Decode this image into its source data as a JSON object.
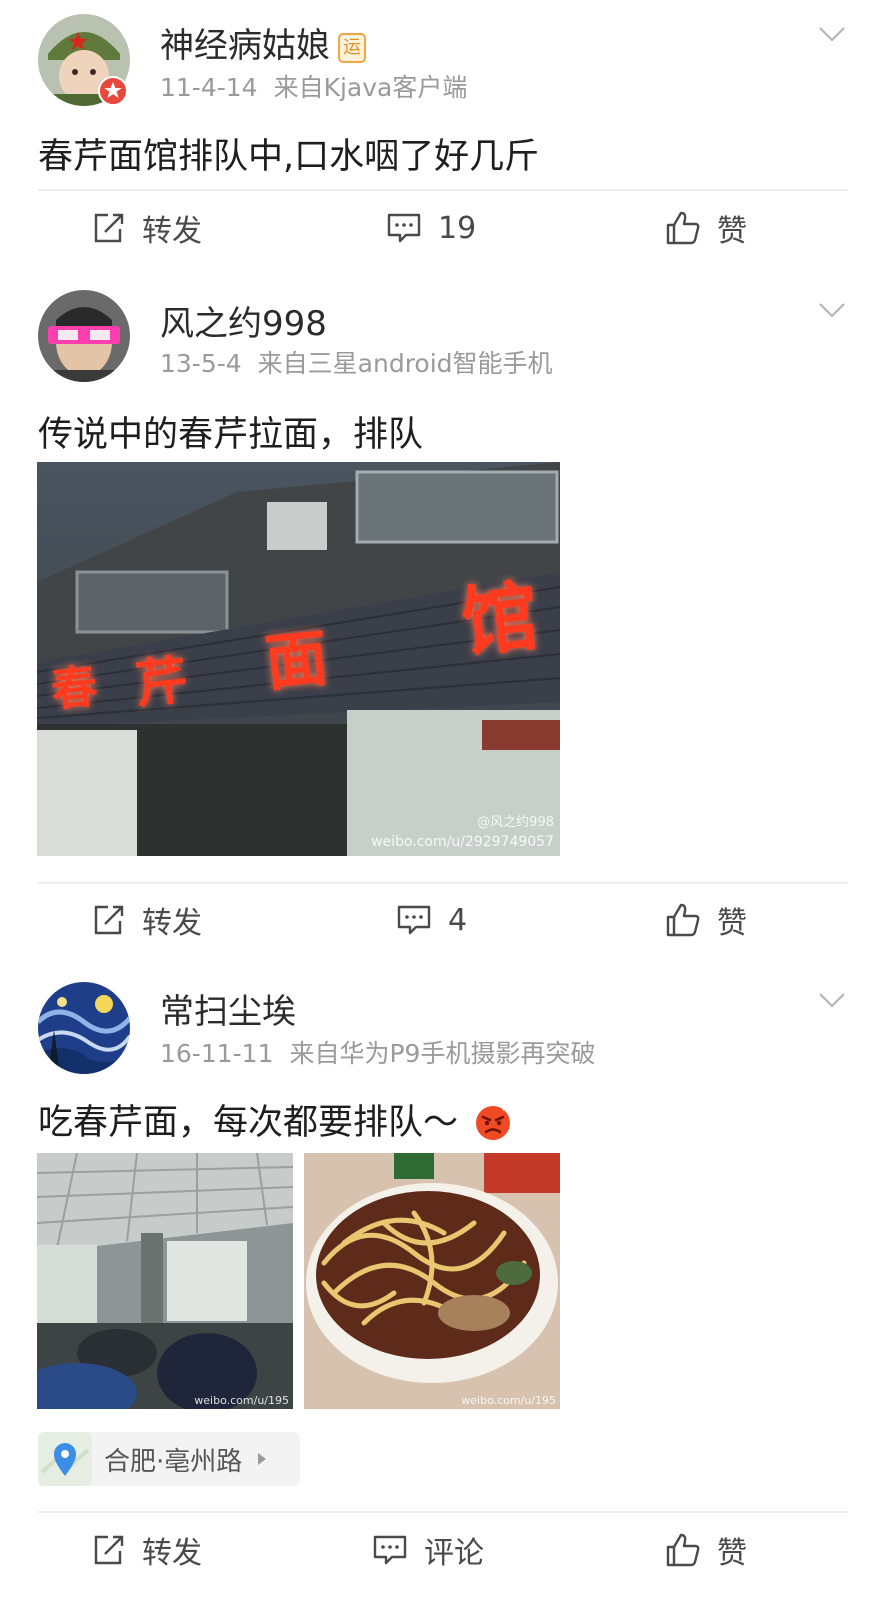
{
  "posts": [
    {
      "username": "神经病姑娘",
      "badge": "运",
      "date": "11-4-14",
      "source": "来自Kjava客户端",
      "text": "春芹面馆排队中,口水咽了好几斤",
      "repost_label": "转发",
      "comment_label": "19",
      "like_label": "赞"
    },
    {
      "username": "风之约998",
      "date": "13-5-4",
      "source": "来自三星android智能手机",
      "text": "传说中的春芹拉面，排队",
      "image_sign_chars": [
        "春",
        "芹",
        "面",
        "馆"
      ],
      "image_watermark_handle": "@风之约998",
      "image_watermark_url": "weibo.com/u/2929749057",
      "repost_label": "转发",
      "comment_label": "4",
      "like_label": "赞"
    },
    {
      "username": "常扫尘埃",
      "date": "16-11-11",
      "source": "来自华为P9手机摄影再突破",
      "text": "吃春芹面，每次都要排队～",
      "image1_watermark": "weibo.com/u/195",
      "image2_watermark": "weibo.com/u/195",
      "location": "合肥·亳州路",
      "repost_label": "转发",
      "comment_label": "评论",
      "like_label": "赞"
    }
  ],
  "icons": {
    "repost": "repost-icon",
    "comment": "comment-icon",
    "like": "thumbs-up-icon",
    "menu": "chevron-down-icon",
    "location": "location-pin-icon",
    "emoji": "angry-face-emoji"
  },
  "colors": {
    "sign_red": "#ff3b1f",
    "pin_blue": "#3a8ee6",
    "vip_orange": "#f2a640"
  }
}
